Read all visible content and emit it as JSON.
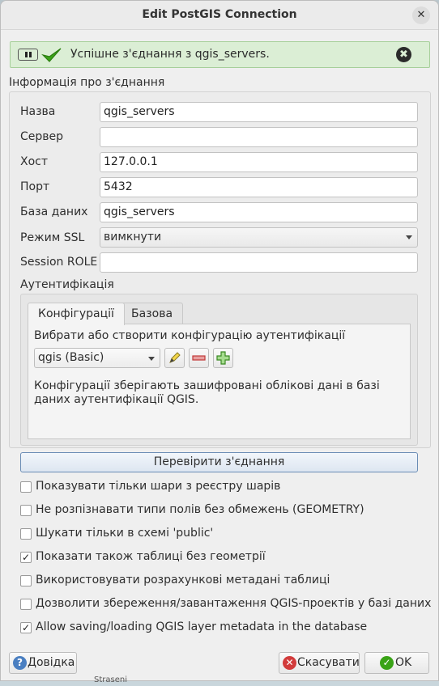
{
  "window": {
    "title": "Edit PostGIS Connection",
    "close_glyph": "✕"
  },
  "message": {
    "text": "Успішне з'єднання з qgis_servers.",
    "close_glyph": "✖"
  },
  "connection_group": {
    "title": "Інформація про з'єднання"
  },
  "fields": {
    "name": {
      "label": "Назва",
      "value": "qgis_servers"
    },
    "service": {
      "label": "Сервер",
      "value": ""
    },
    "host": {
      "label": "Хост",
      "value": "127.0.0.1"
    },
    "port": {
      "label": "Порт",
      "value": "5432"
    },
    "database": {
      "label": "База даних",
      "value": "qgis_servers"
    },
    "ssl": {
      "label": "Режим SSL",
      "value": "вимкнути"
    },
    "session_role": {
      "label": "Session ROLE",
      "value": ""
    }
  },
  "auth": {
    "label": "Аутентифікація",
    "tabs": [
      "Конфігурації",
      "Базова"
    ],
    "choose_label": "Вибрати або створити конфігурацію аутентифікації",
    "config_value": "qgis (Basic)",
    "note": "Конфігурації зберігають зашифровані облікові дані в базі даних аутентифікації QGIS."
  },
  "test_button": "Перевірити з'єднання",
  "options": [
    {
      "label": "Показувати тільки шари з реєстру шарів",
      "checked": false
    },
    {
      "label": "Не розпізнавати типи полів без обмежень (GEOMETRY)",
      "checked": false
    },
    {
      "label": "Шукати тільки в схемі 'public'",
      "checked": false
    },
    {
      "label": "Показати також таблиці без геометрії",
      "checked": true
    },
    {
      "label": "Використовувати розрахункові метадані таблиці",
      "checked": false
    },
    {
      "label": "Дозволити збереження/завантаження QGIS-проектів у базі даних",
      "checked": false
    },
    {
      "label": "Allow saving/loading QGIS layer metadata in the database",
      "checked": true
    }
  ],
  "footer": {
    "help": "Довідка",
    "cancel": "Скасувати",
    "ok": "OK"
  },
  "background_label": "Straseni",
  "colors": {
    "success_bg": "#dbeed5",
    "success_icon": "#3aa317",
    "accent_border": "#6a8cb5"
  }
}
